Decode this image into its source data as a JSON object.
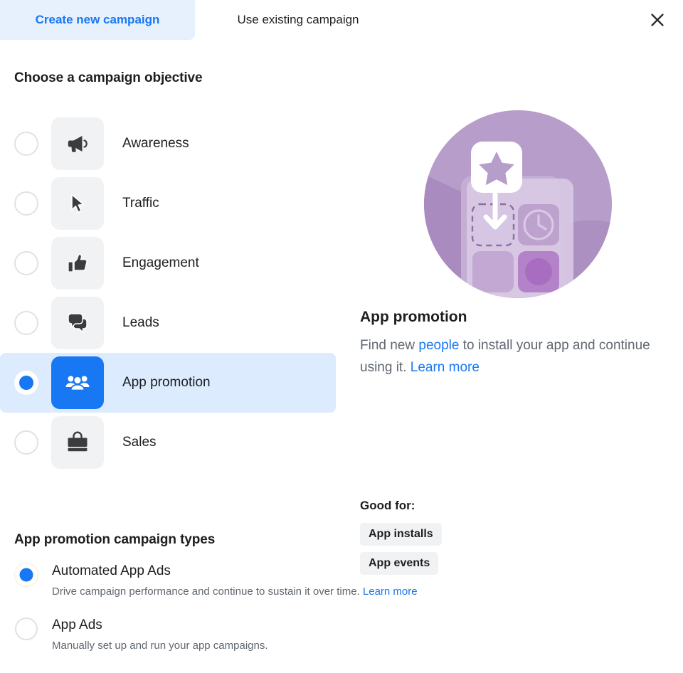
{
  "tabs": {
    "create_new": "Create new campaign",
    "use_existing": "Use existing campaign",
    "close_icon": "close-icon"
  },
  "objective_section": {
    "title": "Choose a campaign objective",
    "items": [
      {
        "label": "Awareness",
        "icon": "megaphone-icon",
        "selected": false
      },
      {
        "label": "Traffic",
        "icon": "cursor-icon",
        "selected": false
      },
      {
        "label": "Engagement",
        "icon": "thumbs-up-icon",
        "selected": false
      },
      {
        "label": "Leads",
        "icon": "speech-bubbles-icon",
        "selected": false
      },
      {
        "label": "App promotion",
        "icon": "people-group-icon",
        "selected": true
      },
      {
        "label": "Sales",
        "icon": "shopping-bag-icon",
        "selected": false
      }
    ]
  },
  "detail": {
    "illustration": "app-install-illustration",
    "title": "App promotion",
    "desc_part1": "Find new ",
    "desc_link1": "people",
    "desc_part2": " to install your app and continue using it. ",
    "desc_link2": "Learn more",
    "good_for_label": "Good for:",
    "chips": [
      "App installs",
      "App events"
    ]
  },
  "campaign_types": {
    "title": "App promotion campaign types",
    "options": [
      {
        "name": "Automated App Ads",
        "desc": "Drive campaign performance and continue to sustain it over time. ",
        "link": "Learn more",
        "selected": true
      },
      {
        "name": "App Ads",
        "desc": "Manually set up and run your app campaigns.",
        "link": "",
        "selected": false
      }
    ]
  },
  "colors": {
    "accent_blue": "#1877f2",
    "selected_row_bg": "#dcebfd",
    "tab_active_bg": "#e7f0fd",
    "tile_bg": "#f1f2f4",
    "illustration_purple": "#b79dc9"
  }
}
